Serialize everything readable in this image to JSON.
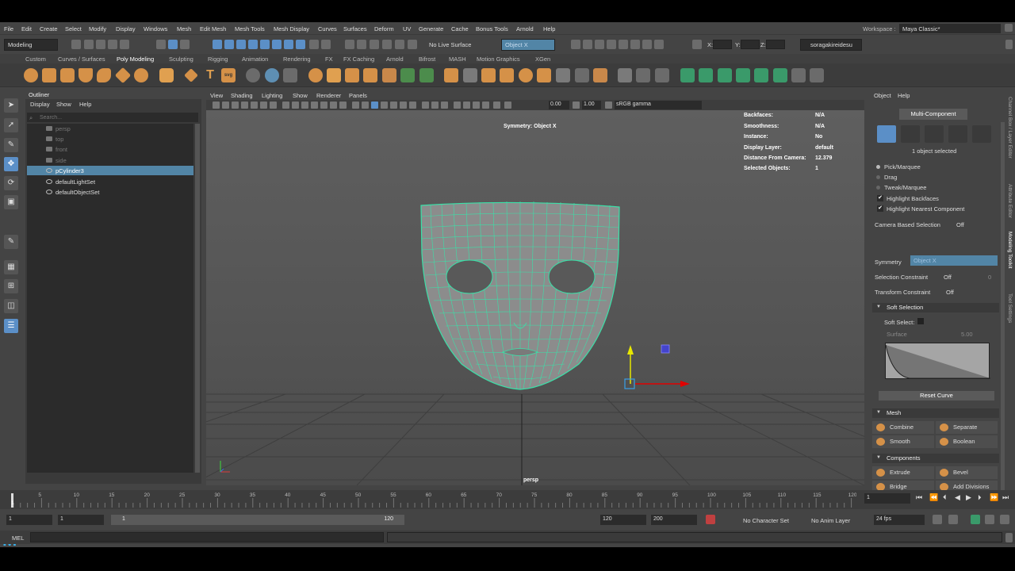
{
  "menubar": {
    "items": [
      "File",
      "Edit",
      "Create",
      "Select",
      "Modify",
      "Display",
      "Windows",
      "Mesh",
      "Edit Mesh",
      "Mesh Tools",
      "Mesh Display",
      "Curves",
      "Surfaces",
      "Deform",
      "UV",
      "Generate",
      "Cache",
      "Bonus Tools",
      "Arnold",
      "Help"
    ],
    "workspace_label": "Workspace :",
    "workspace_value": "Maya Classic*"
  },
  "statusline": {
    "mode": "Modeling",
    "live_surface": "No Live Surface",
    "symmetry": "Object X",
    "x_label": "X:",
    "y_label": "Y:",
    "z_label": "Z:",
    "user": "soragakireidesu"
  },
  "shelf": {
    "tabs": [
      "Custom",
      "Curves / Surfaces",
      "Poly Modeling",
      "Sculpting",
      "Rigging",
      "Animation",
      "Rendering",
      "FX",
      "FX Caching",
      "Arnold",
      "Bifrost",
      "MASH",
      "Motion Graphics",
      "XGen"
    ],
    "active_tab": "Poly Modeling"
  },
  "outliner": {
    "title": "Outliner",
    "menu": [
      "Display",
      "Show",
      "Help"
    ],
    "search_placeholder": "Search...",
    "items": [
      {
        "label": "persp",
        "dim": true
      },
      {
        "label": "top",
        "dim": true
      },
      {
        "label": "front",
        "dim": true
      },
      {
        "label": "side",
        "dim": true
      },
      {
        "label": "pCylinder3",
        "selected": true
      },
      {
        "label": "defaultLightSet"
      },
      {
        "label": "defaultObjectSet"
      }
    ]
  },
  "viewport": {
    "menu": [
      "View",
      "Shading",
      "Lighting",
      "Show",
      "Renderer",
      "Panels"
    ],
    "exposure": "0.00",
    "gamma": "1.00",
    "color_space": "sRGB gamma",
    "symmetry_hud": "Symmetry: Object X",
    "camera": "persp",
    "hud": [
      {
        "label": "Backfaces:",
        "value": "N/A"
      },
      {
        "label": "Smoothness:",
        "value": "N/A"
      },
      {
        "label": "Instance:",
        "value": "No"
      },
      {
        "label": "Display Layer:",
        "value": "default"
      },
      {
        "label": "Distance From Camera:",
        "value": "12.379"
      },
      {
        "label": "Selected Objects:",
        "value": "1"
      }
    ]
  },
  "toolkit": {
    "menu": [
      "Object",
      "Help"
    ],
    "multi_component": "Multi-Component",
    "selected_count": "1 object selected",
    "pick_marquee": "Pick/Marquee",
    "drag": "Drag",
    "tweak_marquee": "Tweak/Marquee",
    "highlight_backfaces": "Highlight Backfaces",
    "highlight_nearest": "Highlight Nearest Component",
    "camera_based_label": "Camera Based Selection",
    "camera_based_value": "Off",
    "symmetry_label": "Symmetry",
    "symmetry_value": "Object X",
    "selection_constraint_label": "Selection Constraint",
    "selection_constraint_value": "Off",
    "selection_constraint_num": "0",
    "transform_constraint_label": "Transform Constraint",
    "transform_constraint_value": "Off",
    "soft_selection": "Soft Selection",
    "soft_select": "Soft Select:",
    "falloff_mode": "Surface",
    "falloff_value": "5.00",
    "reset_curve": "Reset Curve",
    "mesh_section": "Mesh",
    "components_section": "Components",
    "mesh_buttons": [
      "Combine",
      "Separate",
      "Smooth",
      "Boolean"
    ],
    "component_buttons": [
      "Extrude",
      "Bevel",
      "Bridge",
      "Add Divisions"
    ]
  },
  "side_tabs": [
    "Channel Box / Layer Editor",
    "Attribute Editor",
    "Modeling Toolkit",
    "Tool Settings"
  ],
  "time": {
    "ticks": [
      "5",
      "10",
      "15",
      "20",
      "25",
      "30",
      "35",
      "40",
      "45",
      "50",
      "55",
      "60",
      "65",
      "70",
      "75",
      "80",
      "85",
      "90",
      "95",
      "100",
      "105",
      "110",
      "115",
      "120"
    ],
    "current_frame_label": "1",
    "current_frame": "1",
    "start": "1",
    "playback_start": "1",
    "range_start": "1",
    "range_end": "120",
    "playback_end": "120",
    "end": "200",
    "character_set": "No Character Set",
    "anim_layer": "No Anim Layer",
    "fps": "24 fps"
  },
  "command": {
    "label": "MEL"
  }
}
